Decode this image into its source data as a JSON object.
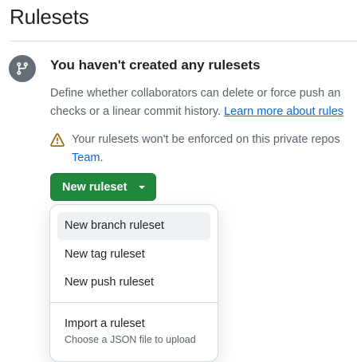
{
  "header": {
    "title": "Rulesets"
  },
  "blankslate": {
    "icon": "git-branch-icon",
    "heading": "You haven't created any rulesets",
    "description_line1": "Define whether collaborators can delete or force push an",
    "description_line2_prefix": "checks or a linear commit history. ",
    "learn_more_link": "Learn more about rules",
    "warning_icon": "alert-triangle-icon",
    "warning_text": "Your rulesets won't be enforced on this private repos",
    "warning_link": "Team."
  },
  "new_ruleset_button": {
    "label": "New ruleset",
    "icon": "triangle-down-icon"
  },
  "menu": {
    "items": [
      {
        "label": "New branch ruleset"
      },
      {
        "label": "New tag ruleset"
      },
      {
        "label": "New push ruleset"
      }
    ],
    "import": {
      "label": "Import a ruleset",
      "description": "Choose a JSON file to upload"
    }
  },
  "colors": {
    "primary_button": "#1f883d",
    "link": "#0969da",
    "warning": "#9a6700",
    "muted_text": "#59636e"
  }
}
